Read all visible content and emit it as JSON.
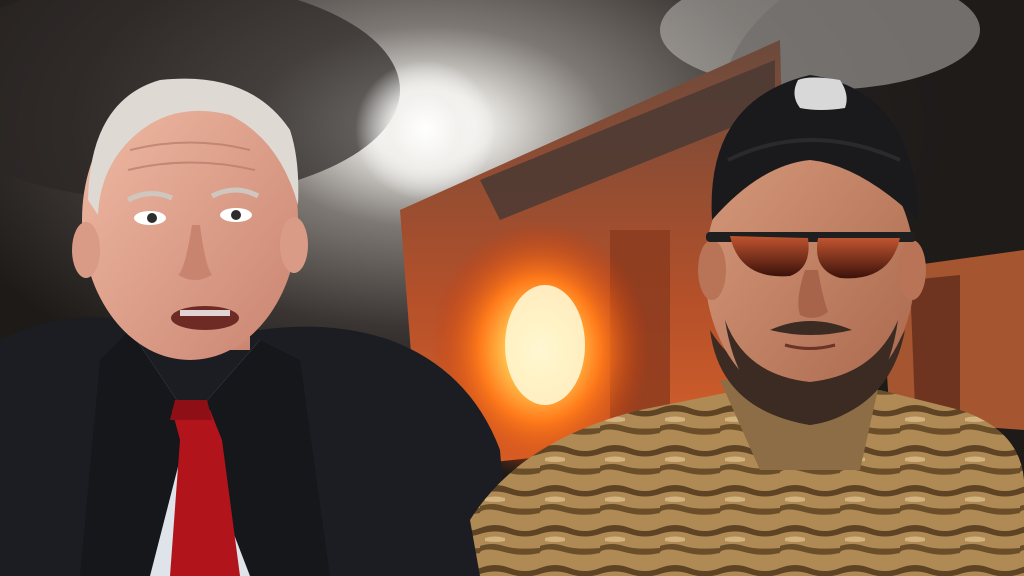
{
  "scene": {
    "description_tags": [
      "composite-photo",
      "smoke",
      "burning-building",
      "two-men"
    ],
    "colors": {
      "smoke_dark": "#2b2725",
      "smoke_light": "#8a8580",
      "fire_core": "#fff4c2",
      "fire_orange": "#ff7a1a",
      "fire_red": "#c2380f",
      "suit": "#1b1d22",
      "shirt": "#dfe3ea",
      "tie": "#b1141b",
      "skin": "#e6a48e",
      "camo_base": "#b08a55",
      "camo_dark": "#5e4424",
      "cap": "#1a1a1c",
      "glasses": "#7a2414"
    }
  }
}
